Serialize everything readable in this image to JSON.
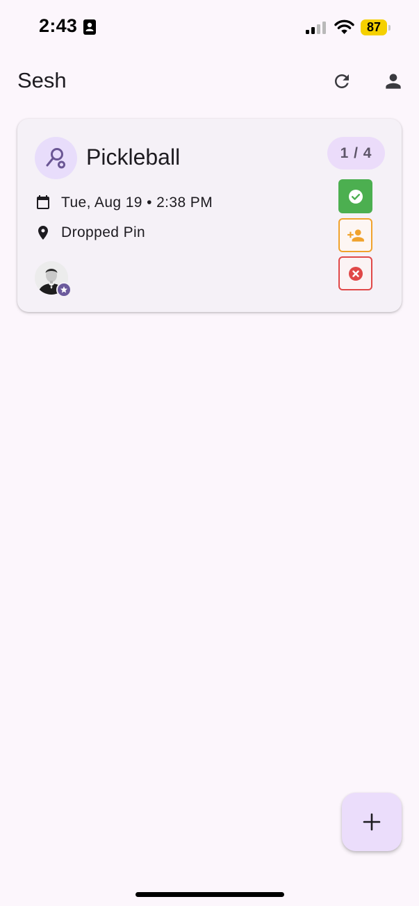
{
  "status_bar": {
    "time": "2:43",
    "battery": "87"
  },
  "app_bar": {
    "title": "Sesh"
  },
  "event": {
    "sport": "Pickleball",
    "count": "1 / 4",
    "date_time": "Tue, Aug 19 • 2:38 PM",
    "location": "Dropped Pin"
  },
  "icons": {
    "refresh": "refresh-icon",
    "account": "account-icon",
    "sport": "pickleball-racket-icon",
    "calendar": "calendar-icon",
    "location": "location-pin-icon",
    "accept": "check-circle-icon",
    "waitlist": "person-add-icon",
    "decline": "cancel-circle-icon",
    "host": "star-icon",
    "add": "plus-icon"
  },
  "colors": {
    "background": "#fcf6fc",
    "card": "#f5f1f7",
    "accent": "#ebdcfa",
    "accept": "#4caf50",
    "waitlist": "#f0a22c",
    "decline": "#e04848",
    "host_badge": "#6b5a9c"
  }
}
